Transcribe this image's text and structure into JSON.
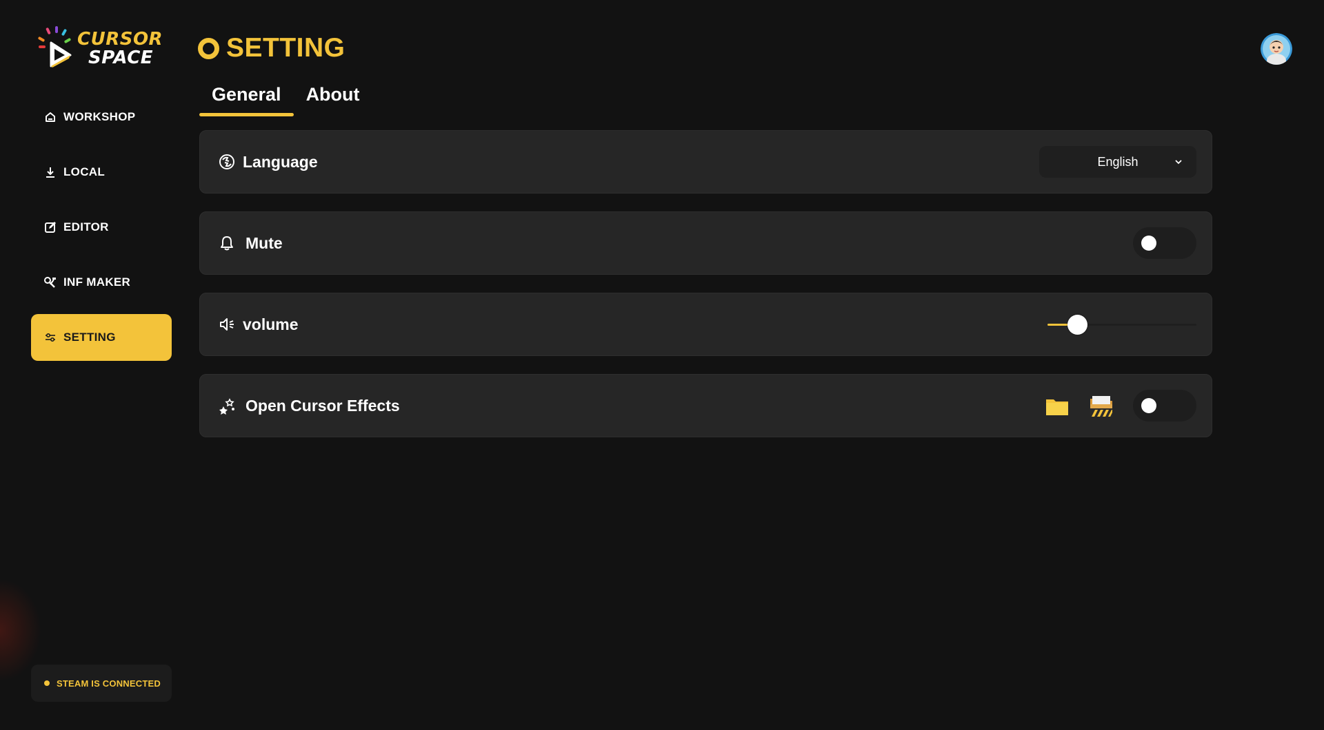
{
  "app": {
    "logo_line1": "CURSOR",
    "logo_line2": "SPACE",
    "accent_color": "#f3c33a"
  },
  "sidebar": {
    "items": [
      {
        "label": "WORKSHOP",
        "icon": "home-icon"
      },
      {
        "label": "LOCAL",
        "icon": "download-icon"
      },
      {
        "label": "EDITOR",
        "icon": "edit-icon"
      },
      {
        "label": "INF MAKER",
        "icon": "tools-icon"
      },
      {
        "label": "SETTING",
        "icon": "sliders-icon",
        "active": true
      }
    ],
    "status": "STEAM IS CONNECTED"
  },
  "header": {
    "title": "SETTING",
    "avatar_icon": "user-avatar"
  },
  "tabs": [
    {
      "label": "General",
      "active": true
    },
    {
      "label": "About",
      "active": false
    }
  ],
  "settings": {
    "language": {
      "label": "Language",
      "icon": "language-icon",
      "value": "English"
    },
    "mute": {
      "label": "Mute",
      "icon": "bell-icon",
      "enabled": false
    },
    "volume": {
      "label": "volume",
      "icon": "speaker-icon",
      "level": 0.2
    },
    "effects": {
      "label": "Open Cursor Effects",
      "icon": "sparkles-icon",
      "enabled": false,
      "buttons": [
        "folder-icon",
        "open-folder-icon"
      ]
    }
  }
}
